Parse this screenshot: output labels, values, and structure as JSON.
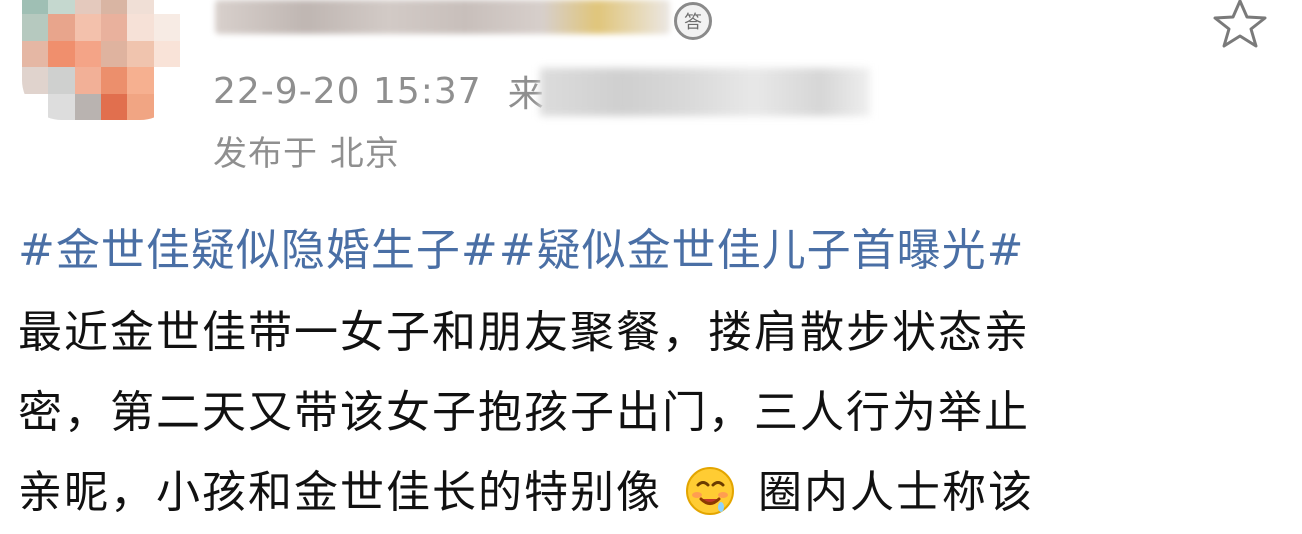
{
  "post": {
    "timestamp": "22-9-20 15:37",
    "source_partial": "来",
    "location": "发布于 北京",
    "verify_badge": "答",
    "hashtags": [
      "#金世佳疑似隐婚生子#",
      "#疑似金世佳儿子首曝光#"
    ],
    "body": {
      "line1": "最近金世佳带一女子和朋友聚餐，搂肩散步状态亲",
      "line2": "密，第二天又带该女子抱孩子出门，三人行为举止",
      "line3_before_emoji": "亲昵，小孩和金世佳长的特别像",
      "line3_after_emoji": "圈内人士称该"
    }
  },
  "icons": {
    "favorite": "star-outline-icon",
    "emoji": "drooling-face-emoji-icon",
    "badge": "verified-answer-badge-icon"
  },
  "colors": {
    "hashtag": "#4a6fa5",
    "meta": "#8f8f8f",
    "body": "#111111"
  }
}
